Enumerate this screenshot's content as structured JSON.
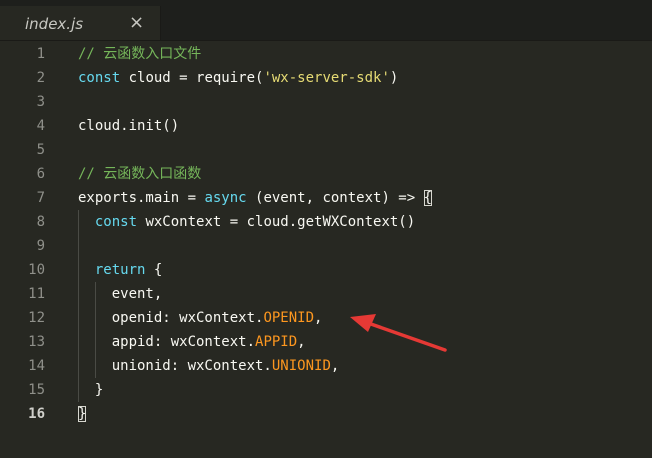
{
  "tab": {
    "title": "index.js",
    "close": "×"
  },
  "lines": [
    {
      "num": "1",
      "indent": 0,
      "tokens": [
        [
          "// 云函数入口文件",
          "comment"
        ]
      ]
    },
    {
      "num": "2",
      "indent": 0,
      "tokens": [
        [
          "const",
          "kw"
        ],
        [
          " cloud = require(",
          ""
        ],
        [
          "'wx-server-sdk'",
          "str"
        ],
        [
          ")",
          ""
        ]
      ]
    },
    {
      "num": "3",
      "indent": 0,
      "tokens": []
    },
    {
      "num": "4",
      "indent": 0,
      "tokens": [
        [
          "cloud.init()",
          ""
        ]
      ]
    },
    {
      "num": "5",
      "indent": 0,
      "tokens": []
    },
    {
      "num": "6",
      "indent": 0,
      "tokens": [
        [
          "// 云函数入口函数",
          "comment"
        ]
      ]
    },
    {
      "num": "7",
      "indent": 0,
      "tokens": [
        [
          "exports.main = ",
          ""
        ],
        [
          "async",
          "kw"
        ],
        [
          " (event, context) => ",
          ""
        ],
        [
          "{",
          "bracket"
        ]
      ]
    },
    {
      "num": "8",
      "indent": 1,
      "tokens": [
        [
          "const",
          "kw"
        ],
        [
          " wxContext = cloud.getWXContext()",
          ""
        ]
      ]
    },
    {
      "num": "9",
      "indent": 1,
      "tokens": []
    },
    {
      "num": "10",
      "indent": 1,
      "tokens": [
        [
          "return",
          "kw"
        ],
        [
          " {",
          ""
        ]
      ]
    },
    {
      "num": "11",
      "indent": 2,
      "tokens": [
        [
          "event,",
          ""
        ]
      ]
    },
    {
      "num": "12",
      "indent": 2,
      "tokens": [
        [
          "openid: wxContext.",
          ""
        ],
        [
          "OPENID",
          "prop"
        ],
        [
          ",",
          ""
        ]
      ]
    },
    {
      "num": "13",
      "indent": 2,
      "tokens": [
        [
          "appid: wxContext.",
          ""
        ],
        [
          "APPID",
          "prop"
        ],
        [
          ",",
          ""
        ]
      ]
    },
    {
      "num": "14",
      "indent": 2,
      "tokens": [
        [
          "unionid: wxContext.",
          ""
        ],
        [
          "UNIONID",
          "prop"
        ],
        [
          ",",
          ""
        ]
      ]
    },
    {
      "num": "15",
      "indent": 1,
      "tokens": [
        [
          "}",
          ""
        ]
      ]
    },
    {
      "num": "16",
      "indent": 0,
      "active": true,
      "tokens": [
        [
          "}",
          "bracket"
        ]
      ]
    }
  ],
  "annotation": {
    "color": "#e53935",
    "points_to_line": "12"
  }
}
